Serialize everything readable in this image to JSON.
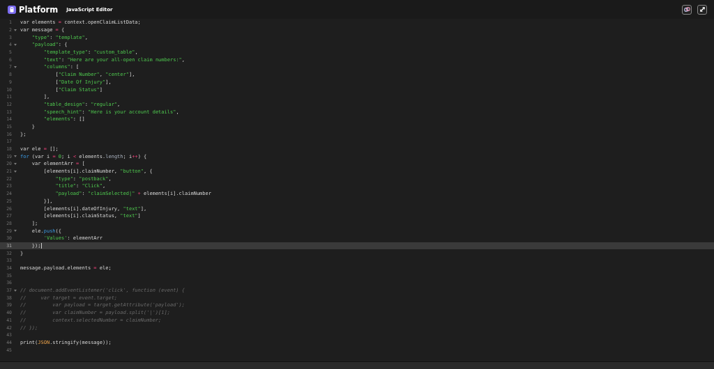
{
  "header": {
    "brand": "Platform",
    "title": "JavaScript Editor"
  },
  "lines": [
    {
      "number": "1",
      "fold": false,
      "selected": false,
      "tokens": [
        {
          "kind": "plain",
          "text": "var elements "
        },
        {
          "kind": "operator",
          "text": "="
        },
        {
          "kind": "plain",
          "text": " context.openClaimListData;"
        }
      ]
    },
    {
      "number": "2",
      "fold": true,
      "selected": false,
      "tokens": [
        {
          "kind": "plain",
          "text": "var message "
        },
        {
          "kind": "operator",
          "text": "="
        },
        {
          "kind": "plain",
          "text": " {"
        }
      ]
    },
    {
      "number": "3",
      "fold": false,
      "selected": false,
      "tokens": [
        {
          "kind": "string",
          "text": "    \"type\""
        },
        {
          "kind": "plain",
          "text": ": "
        },
        {
          "kind": "string",
          "text": "\"template\""
        },
        {
          "kind": "plain",
          "text": ","
        }
      ]
    },
    {
      "number": "4",
      "fold": true,
      "selected": false,
      "tokens": [
        {
          "kind": "string",
          "text": "    \"payload\""
        },
        {
          "kind": "plain",
          "text": ": {"
        }
      ]
    },
    {
      "number": "5",
      "fold": false,
      "selected": false,
      "tokens": [
        {
          "kind": "string",
          "text": "        \"template_type\""
        },
        {
          "kind": "plain",
          "text": ": "
        },
        {
          "kind": "string",
          "text": "\"custom_table\""
        },
        {
          "kind": "plain",
          "text": ","
        }
      ]
    },
    {
      "number": "6",
      "fold": false,
      "selected": false,
      "tokens": [
        {
          "kind": "string",
          "text": "        \"text\""
        },
        {
          "kind": "plain",
          "text": ": "
        },
        {
          "kind": "string",
          "text": "\"Here are your all-open claim numbers:\""
        },
        {
          "kind": "plain",
          "text": ","
        }
      ]
    },
    {
      "number": "7",
      "fold": true,
      "selected": false,
      "tokens": [
        {
          "kind": "string",
          "text": "        \"columns\""
        },
        {
          "kind": "plain",
          "text": ": ["
        }
      ]
    },
    {
      "number": "8",
      "fold": false,
      "selected": false,
      "tokens": [
        {
          "kind": "plain",
          "text": "            ["
        },
        {
          "kind": "string",
          "text": "\"Claim Number\""
        },
        {
          "kind": "plain",
          "text": ", "
        },
        {
          "kind": "string",
          "text": "\"center\""
        },
        {
          "kind": "plain",
          "text": "],"
        }
      ]
    },
    {
      "number": "9",
      "fold": false,
      "selected": false,
      "tokens": [
        {
          "kind": "plain",
          "text": "            ["
        },
        {
          "kind": "string",
          "text": "\"Date Of Injury\""
        },
        {
          "kind": "plain",
          "text": "],"
        }
      ]
    },
    {
      "number": "10",
      "fold": false,
      "selected": false,
      "tokens": [
        {
          "kind": "plain",
          "text": "            ["
        },
        {
          "kind": "string",
          "text": "\"Claim Status\""
        },
        {
          "kind": "plain",
          "text": "]"
        }
      ]
    },
    {
      "number": "11",
      "fold": false,
      "selected": false,
      "tokens": [
        {
          "kind": "plain",
          "text": "        ],"
        }
      ]
    },
    {
      "number": "12",
      "fold": false,
      "selected": false,
      "tokens": [
        {
          "kind": "string",
          "text": "        \"table_design\""
        },
        {
          "kind": "plain",
          "text": ": "
        },
        {
          "kind": "string",
          "text": "\"regular\""
        },
        {
          "kind": "plain",
          "text": ","
        }
      ]
    },
    {
      "number": "13",
      "fold": false,
      "selected": false,
      "tokens": [
        {
          "kind": "string",
          "text": "        \"speech_hint\""
        },
        {
          "kind": "plain",
          "text": ": "
        },
        {
          "kind": "string",
          "text": "\"Here is your account details\""
        },
        {
          "kind": "plain",
          "text": ","
        }
      ]
    },
    {
      "number": "14",
      "fold": false,
      "selected": false,
      "tokens": [
        {
          "kind": "string",
          "text": "        \"elements\""
        },
        {
          "kind": "plain",
          "text": ": []"
        }
      ]
    },
    {
      "number": "15",
      "fold": false,
      "selected": false,
      "tokens": [
        {
          "kind": "plain",
          "text": "    }"
        }
      ]
    },
    {
      "number": "16",
      "fold": false,
      "selected": false,
      "tokens": [
        {
          "kind": "plain",
          "text": "};"
        }
      ]
    },
    {
      "number": "17",
      "fold": false,
      "selected": false
    },
    {
      "number": "18",
      "fold": false,
      "selected": false,
      "tokens": [
        {
          "kind": "plain",
          "text": "var ele "
        },
        {
          "kind": "operator",
          "text": "="
        },
        {
          "kind": "plain",
          "text": " [];"
        }
      ]
    },
    {
      "number": "19",
      "fold": true,
      "selected": false,
      "tokens": [
        {
          "kind": "keyword",
          "text": "for"
        },
        {
          "kind": "plain",
          "text": " (var i "
        },
        {
          "kind": "operator",
          "text": "="
        },
        {
          "kind": "number",
          "text": " 0"
        },
        {
          "kind": "plain",
          "text": "; i "
        },
        {
          "kind": "operator",
          "text": "<"
        },
        {
          "kind": "plain",
          "text": " elements."
        },
        {
          "kind": "property",
          "text": "length"
        },
        {
          "kind": "plain",
          "text": "; i"
        },
        {
          "kind": "operator",
          "text": "++"
        },
        {
          "kind": "plain",
          "text": ") {"
        }
      ]
    },
    {
      "number": "20",
      "fold": true,
      "selected": false,
      "tokens": [
        {
          "kind": "plain",
          "text": "    var elementArr "
        },
        {
          "kind": "operator",
          "text": "="
        },
        {
          "kind": "plain",
          "text": " ["
        }
      ]
    },
    {
      "number": "21",
      "fold": true,
      "selected": false,
      "tokens": [
        {
          "kind": "plain",
          "text": "        [elements[i].claimNumber, "
        },
        {
          "kind": "string",
          "text": "\"button\""
        },
        {
          "kind": "plain",
          "text": ", {"
        }
      ]
    },
    {
      "number": "22",
      "fold": false,
      "selected": false,
      "tokens": [
        {
          "kind": "string",
          "text": "            \"type\""
        },
        {
          "kind": "plain",
          "text": ": "
        },
        {
          "kind": "string",
          "text": "\"postback\""
        },
        {
          "kind": "plain",
          "text": ","
        }
      ]
    },
    {
      "number": "23",
      "fold": false,
      "selected": false,
      "tokens": [
        {
          "kind": "string",
          "text": "            \"title\""
        },
        {
          "kind": "plain",
          "text": ": "
        },
        {
          "kind": "string",
          "text": "\"Click\""
        },
        {
          "kind": "plain",
          "text": ","
        }
      ]
    },
    {
      "number": "24",
      "fold": false,
      "selected": false,
      "tokens": [
        {
          "kind": "string",
          "text": "            \"payload\""
        },
        {
          "kind": "plain",
          "text": ": "
        },
        {
          "kind": "string",
          "text": "\"claimSelected|\""
        },
        {
          "kind": "operator",
          "text": " +"
        },
        {
          "kind": "plain",
          "text": " elements[i].claimNumber"
        }
      ]
    },
    {
      "number": "25",
      "fold": false,
      "selected": false,
      "tokens": [
        {
          "kind": "plain",
          "text": "        }],"
        }
      ]
    },
    {
      "number": "26",
      "fold": false,
      "selected": false,
      "tokens": [
        {
          "kind": "plain",
          "text": "        [elements[i].dateOfInjury, "
        },
        {
          "kind": "string",
          "text": "\"text\""
        },
        {
          "kind": "plain",
          "text": "],"
        }
      ]
    },
    {
      "number": "27",
      "fold": false,
      "selected": false,
      "tokens": [
        {
          "kind": "plain",
          "text": "        [elements[i].claimStatus, "
        },
        {
          "kind": "string",
          "text": "\"text\""
        },
        {
          "kind": "plain",
          "text": "]"
        }
      ]
    },
    {
      "number": "28",
      "fold": false,
      "selected": false,
      "tokens": [
        {
          "kind": "plain",
          "text": "    ];"
        }
      ]
    },
    {
      "number": "29",
      "fold": true,
      "selected": false,
      "tokens": [
        {
          "kind": "plain",
          "text": "    ele."
        },
        {
          "kind": "keyword",
          "text": "push"
        },
        {
          "kind": "plain",
          "text": "({"
        }
      ]
    },
    {
      "number": "30",
      "fold": false,
      "selected": false,
      "tokens": [
        {
          "kind": "string",
          "text": "        'Values'"
        },
        {
          "kind": "plain",
          "text": ": elementArr"
        }
      ]
    },
    {
      "number": "31",
      "fold": false,
      "selected": true,
      "tokens": [
        {
          "kind": "plain",
          "text": "    });"
        }
      ]
    },
    {
      "number": "32",
      "fold": false,
      "selected": false,
      "tokens": [
        {
          "kind": "plain",
          "text": "}"
        }
      ]
    },
    {
      "number": "33",
      "fold": false,
      "selected": false
    },
    {
      "number": "34",
      "fold": false,
      "selected": false,
      "tokens": [
        {
          "kind": "plain",
          "text": "message.payload.elements "
        },
        {
          "kind": "operator",
          "text": "="
        },
        {
          "kind": "plain",
          "text": " ele;"
        }
      ]
    },
    {
      "number": "35",
      "fold": false,
      "selected": false
    },
    {
      "number": "36",
      "fold": false,
      "selected": false
    },
    {
      "number": "37",
      "fold": true,
      "selected": false,
      "tokens": [
        {
          "kind": "comment",
          "text": "// document.addEventListener('click', function (event) {"
        }
      ]
    },
    {
      "number": "38",
      "fold": false,
      "selected": false,
      "tokens": [
        {
          "kind": "comment",
          "text": "//     var target = event.target;"
        }
      ]
    },
    {
      "number": "39",
      "fold": false,
      "selected": false,
      "tokens": [
        {
          "kind": "comment",
          "text": "//         var payload = target.getAttribute('payload');"
        }
      ]
    },
    {
      "number": "40",
      "fold": false,
      "selected": false,
      "tokens": [
        {
          "kind": "comment",
          "text": "//         var claimNumber = payload.split('|')[1];"
        }
      ]
    },
    {
      "number": "41",
      "fold": false,
      "selected": false,
      "tokens": [
        {
          "kind": "comment",
          "text": "//         context.selectedNumber = claimNumber;"
        }
      ]
    },
    {
      "number": "42",
      "fold": false,
      "selected": false,
      "tokens": [
        {
          "kind": "comment",
          "text": "// });"
        }
      ]
    },
    {
      "number": "43",
      "fold": false,
      "selected": false
    },
    {
      "number": "44",
      "fold": false,
      "selected": false,
      "tokens": [
        {
          "kind": "plain",
          "text": "print("
        },
        {
          "kind": "builtin",
          "text": "JSON"
        },
        {
          "kind": "plain",
          "text": ".stringify(message));"
        }
      ]
    },
    {
      "number": "45",
      "fold": false,
      "selected": false
    }
  ]
}
